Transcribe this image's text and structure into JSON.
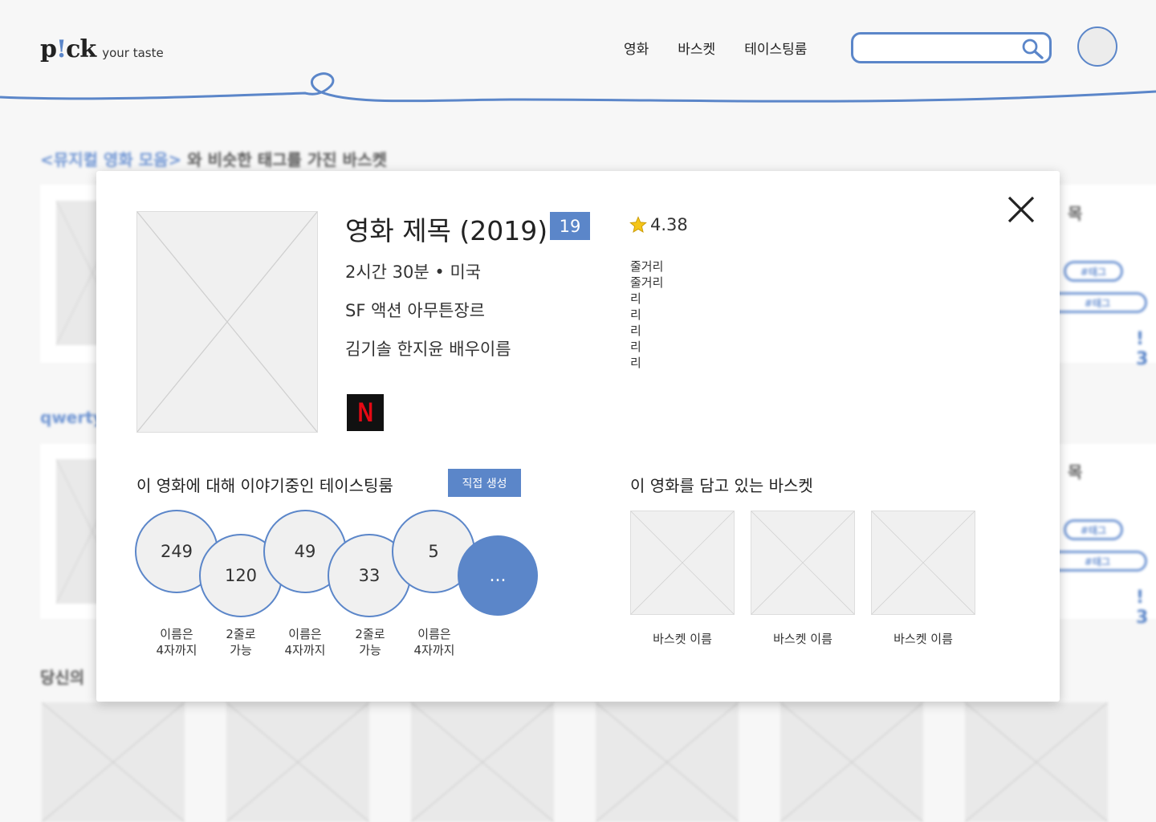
{
  "header": {
    "logo_main": "p!ck",
    "logo_sub": "your taste",
    "nav": [
      "영화",
      "바스켓",
      "테이스팅룸"
    ],
    "search_placeholder": "",
    "search_icon": "search-icon",
    "avatar_icon": "user-avatar"
  },
  "background": {
    "section1_highlight": "<뮤지컬 영화 모음>",
    "section1_rest": " 와 비슷한 태그를 가진 바스켓",
    "section2_title": "qwerty",
    "section3_prefix": "당신의",
    "side_title": "목",
    "tag_label": "#태그",
    "side_mark": "! 3"
  },
  "modal": {
    "title": "영화 제목 (2019)",
    "age_rating": "19",
    "runtime_country": "2시간 30분 • 미국",
    "genres": "SF 액션 아무튼장르",
    "cast": "김기솔 한지윤 배우이름",
    "streaming_icon": "netflix-icon",
    "streaming_letter": "N",
    "rating": "4.38",
    "plot_lines": [
      "줄거리",
      "줄거리",
      "리",
      "리",
      "리",
      "리",
      "리"
    ],
    "rooms_title": "이 영화에 대해 이야기중인 테이스팅룸",
    "create_button": "직접 생성",
    "rooms": [
      {
        "count": "249",
        "label": [
          "이름은",
          "4자까지"
        ]
      },
      {
        "count": "120",
        "label": [
          "2줄로",
          "가능"
        ]
      },
      {
        "count": "49",
        "label": [
          "이름은",
          "4자까지"
        ]
      },
      {
        "count": "33",
        "label": [
          "2줄로",
          "가능"
        ]
      },
      {
        "count": "5",
        "label": [
          "이름은",
          "4자까지"
        ]
      }
    ],
    "more_rooms": "...",
    "baskets_title": "이 영화를 담고 있는 바스켓",
    "baskets": [
      "바스켓 이름",
      "바스켓 이름",
      "바스켓 이름"
    ],
    "close_icon": "close-icon"
  },
  "colors": {
    "accent": "#5b86c9",
    "placeholder": "#f0f0f0",
    "netflix_red": "#e50914"
  }
}
